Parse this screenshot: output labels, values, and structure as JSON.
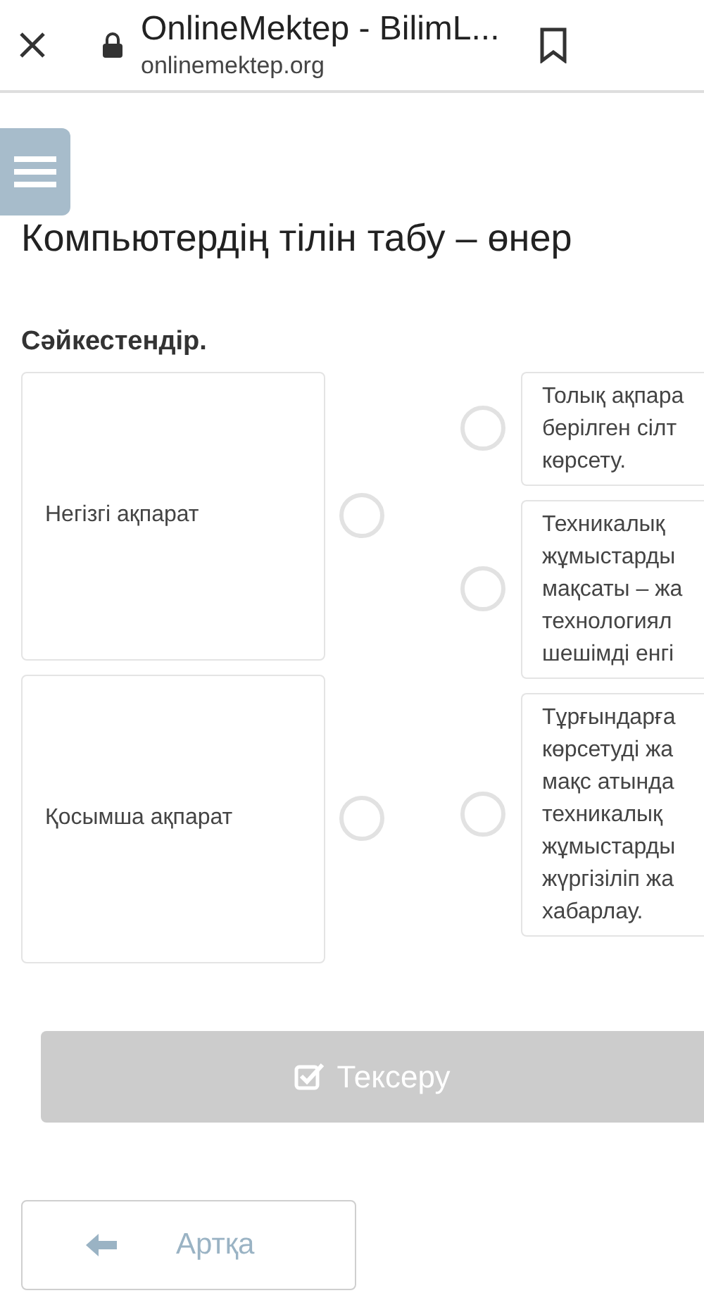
{
  "browser": {
    "title": "OnlineMektep - BilimL...",
    "url": "onlinemektep.org"
  },
  "page": {
    "title": "Компьютердің тілін табу – өнер",
    "instruction": "Сәйкестендір."
  },
  "left_items": [
    {
      "text": "Негізгі ақпарат",
      "selected": false
    },
    {
      "text": "Қосымша ақпарат",
      "selected": false
    }
  ],
  "right_items": [
    {
      "lines": [
        "Толық ақпара",
        "берілген сілт",
        "көрсету."
      ],
      "selected": false
    },
    {
      "lines": [
        "Техникалық",
        "жұмыстарды",
        "мақсаты – жа",
        "технологиял",
        "шешімді енгі"
      ],
      "selected": false
    },
    {
      "lines": [
        "Тұрғындарға",
        "көрсетуді жа",
        "мақс атында",
        "техникалық",
        "жұмыстарды",
        "жүргізіліп жа",
        "хабарлау."
      ],
      "selected": false
    }
  ],
  "check_button": {
    "label": "Тексеру",
    "disabled": true
  },
  "back_button": {
    "label": "Артқа"
  }
}
